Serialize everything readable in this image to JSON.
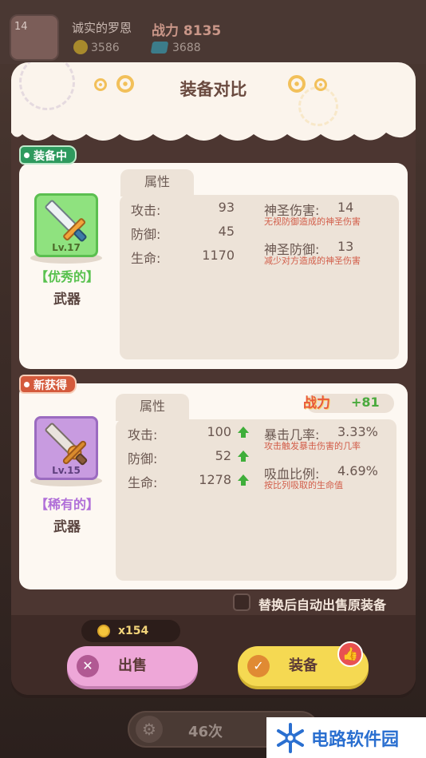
{
  "background": {
    "player_level": "14",
    "player_name": "诚实的罗恩",
    "combat_power_label": "战力 8135",
    "gold": "3586",
    "gems": "3688",
    "bottom_count": "46次"
  },
  "dialog": {
    "title": "装备对比",
    "equipped": {
      "tag": "装备中",
      "level": "Lv.17",
      "quality": "【优秀的】",
      "type": "武器",
      "attr_tab": "属性",
      "stats": [
        {
          "label": "攻击:",
          "value": "93"
        },
        {
          "label": "防御:",
          "value": "45"
        },
        {
          "label": "生命:",
          "value": "1170"
        }
      ],
      "specials": [
        {
          "name": "神圣伤害:",
          "value": "14",
          "desc": "无视防御造成的神圣伤害"
        },
        {
          "name": "神圣防御:",
          "value": "13",
          "desc": "减少对方造成的神圣伤害"
        }
      ]
    },
    "new_item": {
      "tag": "新获得",
      "level": "Lv.15",
      "quality": "【稀有的】",
      "type": "武器",
      "attr_tab": "属性",
      "power_label": "战力",
      "power_diff": "+81",
      "stats": [
        {
          "label": "攻击:",
          "value": "100"
        },
        {
          "label": "防御:",
          "value": "52"
        },
        {
          "label": "生命:",
          "value": "1278"
        }
      ],
      "specials": [
        {
          "name": "暴击几率:",
          "value": "3.33%",
          "desc": "攻击触发暴击伤害的几率"
        },
        {
          "name": "吸血比例:",
          "value": "4.69%",
          "desc": "按比列吸取的生命值"
        }
      ]
    },
    "auto_sell_label": "替换后自动出售原装备",
    "auto_sell_checked": false,
    "sell_price": "x154",
    "sell_button": "出售",
    "equip_button": "装备"
  },
  "watermark": {
    "text": "电路软件园"
  },
  "colors": {
    "accent_green": "#58c14e",
    "accent_purple": "#b06fd8",
    "power_red": "#e85a3b",
    "sell_pink": "#eea7d8",
    "equip_yellow": "#f5d952"
  }
}
